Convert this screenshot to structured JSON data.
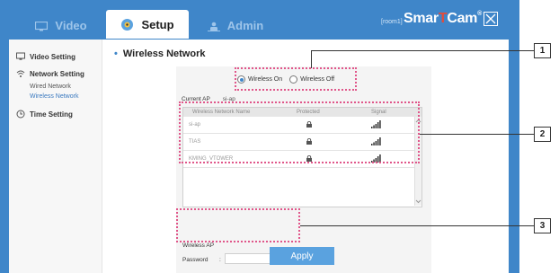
{
  "tabs": [
    {
      "label": "Video",
      "icon": "monitor-icon"
    },
    {
      "label": "Setup",
      "icon": "globe-gear-icon",
      "active": true
    },
    {
      "label": "Admin",
      "icon": "users-icon"
    }
  ],
  "header": {
    "room": "[room1]",
    "brand_a": "Smar",
    "brand_b": "T",
    "brand_c": "Cam",
    "brand_mark": "®"
  },
  "sidebar": {
    "video_setting": "Video Setting",
    "network_setting": "Network Setting",
    "wired_network": "Wired Network",
    "wireless_network": "Wireless Network",
    "time_setting": "Time Setting"
  },
  "page": {
    "title": "Wireless Network"
  },
  "wireless": {
    "on_label": "Wireless On",
    "off_label": "Wireless Off",
    "selected": "on"
  },
  "current_ap": {
    "label": "Current AP",
    "value": "si-ap"
  },
  "ap_list": {
    "headers": [
      "Wireless Network Name",
      "Protected",
      "Signal"
    ],
    "rows": [
      {
        "name": "si-ap"
      },
      {
        "name": "TIAS"
      },
      {
        "name": "KMING_VTOWER"
      }
    ]
  },
  "form": {
    "wireless_ap_label": "Wireless AP",
    "password_label": "Password",
    "password_colon": ":"
  },
  "apply_label": "Apply",
  "callouts": [
    "1",
    "2",
    "3"
  ],
  "colors": {
    "frame_blue": "#3f86c9",
    "highlight_pink": "#e0568a",
    "apply_blue": "#5aa2df"
  }
}
